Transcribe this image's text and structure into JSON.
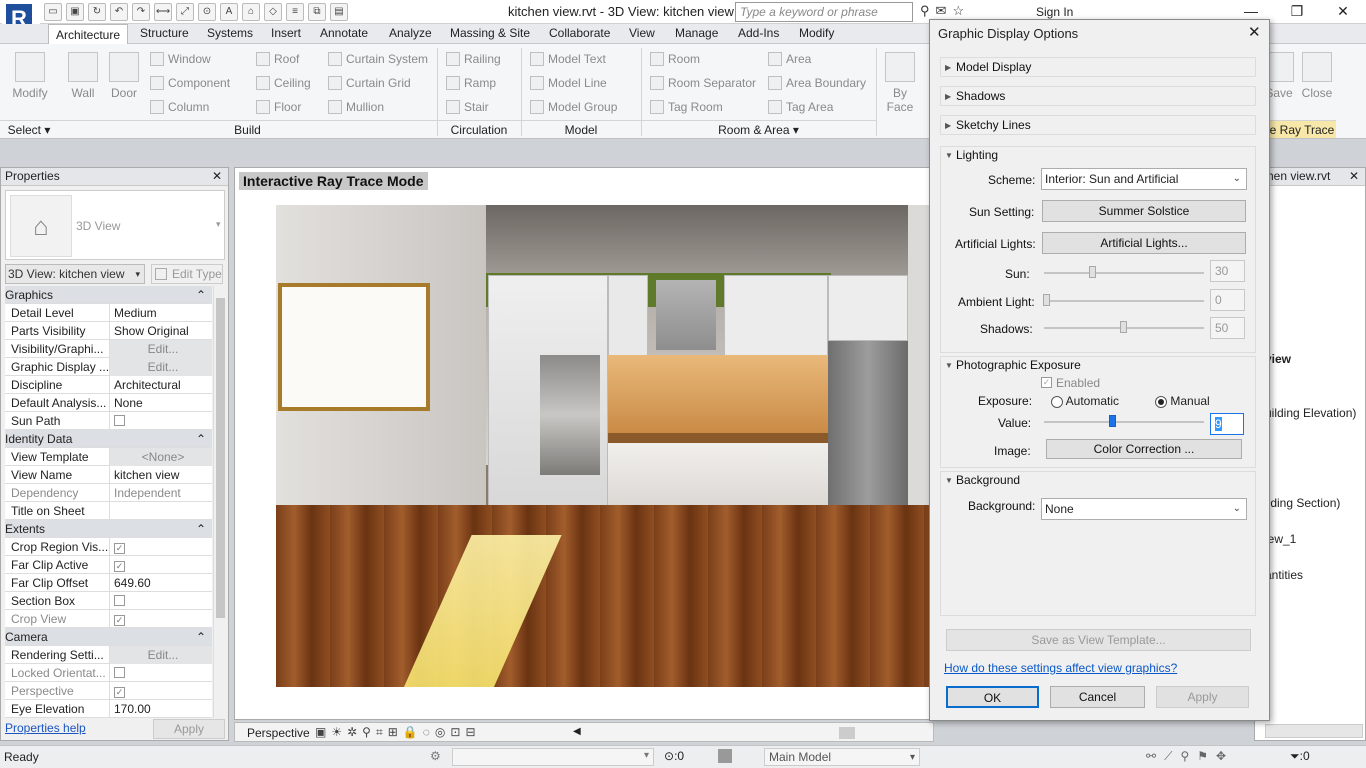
{
  "window": {
    "title": "kitchen view.rvt - 3D View: kitchen view",
    "search_placeholder": "Type a keyword or phrase",
    "sign_in": "Sign In"
  },
  "tabs": [
    "Architecture",
    "Structure",
    "Systems",
    "Insert",
    "Annotate",
    "Analyze",
    "Massing & Site",
    "Collaborate",
    "View",
    "Manage",
    "Add-Ins",
    "Modify"
  ],
  "ribbon": {
    "select": "Select",
    "modify": "Modify",
    "wall": "Wall",
    "door": "Door",
    "window": "Window",
    "component": "Component",
    "column": "Column",
    "roof": "Roof",
    "ceiling": "Ceiling",
    "floor": "Floor",
    "curtain_system": "Curtain System",
    "curtain_grid": "Curtain Grid",
    "mullion": "Mullion",
    "railing": "Railing",
    "ramp": "Ramp",
    "stair": "Stair",
    "model_text": "Model Text",
    "model_line": "Model Line",
    "model_group": "Model Group",
    "room": "Room",
    "room_separator": "Room Separator",
    "tag_room": "Tag Room",
    "area": "Area",
    "area_boundary": "Area Boundary",
    "tag_area": "Tag Area",
    "by_face": "By Face",
    "save": "Save",
    "close": "Close",
    "ray_trace": "ve Ray Trace",
    "panels": {
      "build": "Build",
      "circulation": "Circulation",
      "model": "Model",
      "room_area": "Room & Area"
    }
  },
  "properties": {
    "title": "Properties",
    "type_name": "3D View",
    "view_selector": "3D View: kitchen view",
    "edit_type": "Edit Type",
    "groups": {
      "graphics": "Graphics",
      "identity": "Identity Data",
      "extents": "Extents",
      "camera": "Camera"
    },
    "rows": {
      "detail_level": {
        "k": "Detail Level",
        "v": "Medium"
      },
      "parts_visibility": {
        "k": "Parts Visibility",
        "v": "Show Original"
      },
      "visibility_graphics": {
        "k": "Visibility/Graphi...",
        "v": "Edit..."
      },
      "graphic_display": {
        "k": "Graphic Display ...",
        "v": "Edit..."
      },
      "discipline": {
        "k": "Discipline",
        "v": "Architectural"
      },
      "default_analysis": {
        "k": "Default Analysis...",
        "v": "None"
      },
      "sun_path": {
        "k": "Sun Path",
        "v": ""
      },
      "view_template": {
        "k": "View Template",
        "v": "<None>"
      },
      "view_name": {
        "k": "View Name",
        "v": "kitchen view"
      },
      "dependency": {
        "k": "Dependency",
        "v": "Independent"
      },
      "title_on_sheet": {
        "k": "Title on Sheet",
        "v": ""
      },
      "crop_region_visible": {
        "k": "Crop Region Vis...",
        "v": ""
      },
      "far_clip_active": {
        "k": "Far Clip Active",
        "v": ""
      },
      "far_clip_offset": {
        "k": "Far Clip Offset",
        "v": "649.60"
      },
      "section_box": {
        "k": "Section Box",
        "v": ""
      },
      "crop_view": {
        "k": "Crop View",
        "v": ""
      },
      "rendering_settings": {
        "k": "Rendering Setti...",
        "v": "Edit..."
      },
      "locked_orientation": {
        "k": "Locked Orientat...",
        "v": ""
      },
      "perspective": {
        "k": "Perspective",
        "v": ""
      },
      "eye_elevation": {
        "k": "Eye Elevation",
        "v": "170.00"
      }
    },
    "help_link": "Properties help",
    "apply": "Apply"
  },
  "viewport": {
    "mode_label": "Interactive Ray Trace Mode",
    "view_mode": "Perspective"
  },
  "right_panel": {
    "title_fragment": "hen view.rvt",
    "items": [
      "view",
      "uilding Elevation)",
      "ilding Section)",
      "iew_1",
      "antities"
    ]
  },
  "status": {
    "ready": "Ready",
    "selection_count": ":0",
    "main_model": "Main Model",
    "filter_count": ":0"
  },
  "dialog": {
    "title": "Graphic Display Options",
    "sections": {
      "model_display": "Model Display",
      "shadows": "Shadows",
      "sketchy_lines": "Sketchy Lines",
      "lighting": "Lighting",
      "photographic_exposure": "Photographic Exposure",
      "background": "Background"
    },
    "lighting": {
      "scheme_label": "Scheme:",
      "scheme_value": "Interior: Sun and Artificial",
      "sun_setting_label": "Sun Setting:",
      "sun_setting_value": "Summer Solstice",
      "artificial_lights_label": "Artificial Lights:",
      "artificial_lights_button": "Artificial Lights...",
      "sun_label": "Sun:",
      "sun_value": "30",
      "ambient_label": "Ambient Light:",
      "ambient_value": "0",
      "shadows_label": "Shadows:",
      "shadows_value": "50"
    },
    "exposure": {
      "enabled_label": "Enabled",
      "exposure_label": "Exposure:",
      "automatic": "Automatic",
      "manual": "Manual",
      "value_label": "Value:",
      "value": "9",
      "image_label": "Image:",
      "color_correction": "Color Correction ..."
    },
    "background": {
      "label": "Background:",
      "value": "None"
    },
    "save_template": "Save as View Template...",
    "help_link": "How do these settings affect view graphics?",
    "ok": "OK",
    "cancel": "Cancel",
    "apply": "Apply"
  }
}
